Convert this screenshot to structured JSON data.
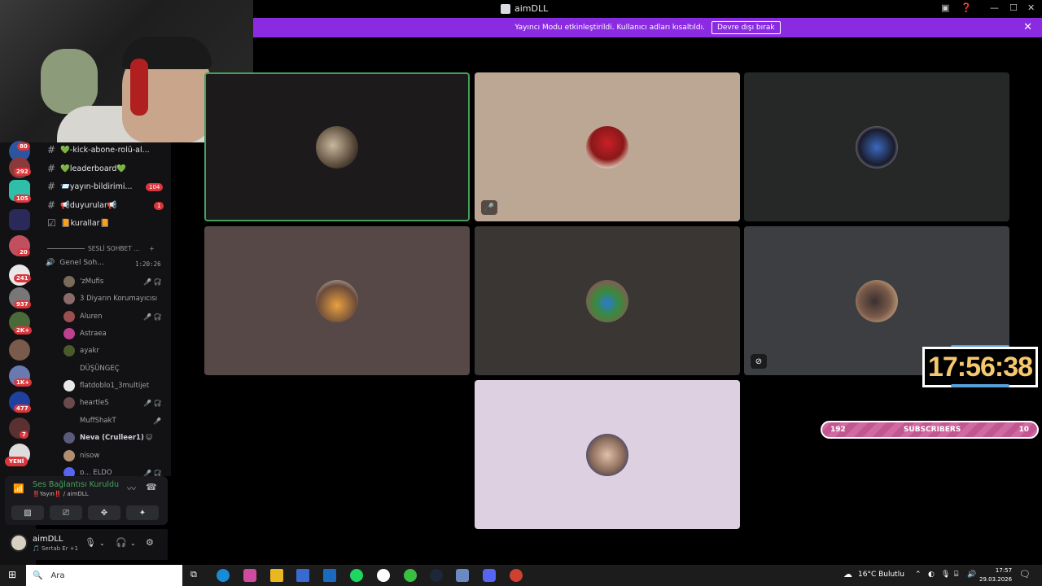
{
  "window": {
    "title": "aimDLL",
    "logo_icon": "discord-window-icon"
  },
  "banner": {
    "message": "Yayıncı Modu etkinleştirildi. Kullanıcı adları kısaltıldı.",
    "button": "Devre dışı bırak",
    "color": "#8a2be2"
  },
  "rail": {
    "badges": [
      "80",
      "292",
      "105",
      "20",
      "241",
      "937",
      "2K+",
      "1K+",
      "477",
      "7"
    ],
    "new_label": "YENİ"
  },
  "channels": [
    {
      "prefix": "#",
      "name": "💚-kick-abone-rolü-al...",
      "badge": ""
    },
    {
      "prefix": "#",
      "name": "💚leaderboard💚",
      "badge": ""
    },
    {
      "prefix": "#",
      "name": "📨yayın-bildirimi...",
      "badge": "104"
    },
    {
      "prefix": "#",
      "name": "📢duyurular📢",
      "badge": "1"
    },
    {
      "prefix": "☑",
      "name": "📙kurallar📙",
      "badge": ""
    }
  ],
  "voice_category": "SESLİ SOHBET ...",
  "voice_channel": {
    "name": "Genel Soh...",
    "time": "1:20:26"
  },
  "voice_users": [
    {
      "name": "'zMufis",
      "icons": "🎤̸ 🎧̸",
      "color": "#7a6a5a"
    },
    {
      "name": "3 Diyarın Korumayıcısı",
      "icons": "",
      "color": "#8a6a6a"
    },
    {
      "name": "Aluren",
      "icons": "🎤̸ 🎧̸",
      "color": "#9a5050"
    },
    {
      "name": "Astraea",
      "icons": "",
      "color": "#c04090"
    },
    {
      "name": "ayakr",
      "icons": "",
      "color": "#4a5a2a"
    },
    {
      "name": "DÜŞÜNGEÇ",
      "icons": "",
      "color": "#121214"
    },
    {
      "name": "flatdoblo1_3multijet",
      "icons": "",
      "color": "#e8e8e8"
    },
    {
      "name": "heartleS",
      "icons": "🎤̸ 🎧̸",
      "color": "#6a4a4a"
    },
    {
      "name": "MuffShakT",
      "icons": "🎤̸",
      "color": "#121214"
    },
    {
      "name": "Neva (Crulleer1)",
      "icons": "😺",
      "color": "#5a5a7a"
    },
    {
      "name": "nisow",
      "icons": "",
      "color": "#b09070"
    },
    {
      "name": "ɒ... ELDO",
      "icons": "🎤̸ 🎧̸",
      "color": "#5865f2"
    }
  ],
  "voice_panel": {
    "status": "Ses Bağlantısı Kuruldu",
    "sub": "‼️Yayın‼️ / aimDLL"
  },
  "user_panel": {
    "name": "aimDLL",
    "status": "🎵 Sertab Er +1"
  },
  "overlay": {
    "clock": "17:56:38",
    "subs_left": "192",
    "subs_label": "SUBSCRIBERS",
    "subs_right": "10"
  },
  "taskbar": {
    "search_placeholder": "Ara",
    "weather": "16°C  Bulutlu",
    "time": "17:57",
    "date": "29.03.2026"
  }
}
